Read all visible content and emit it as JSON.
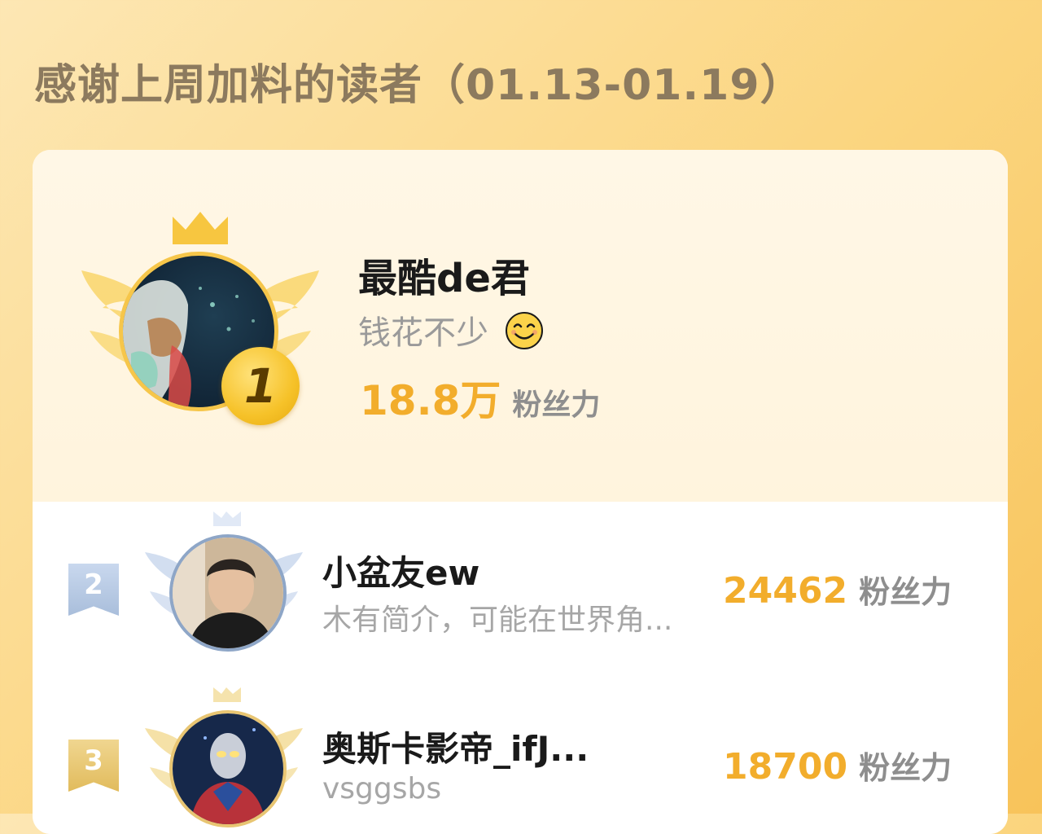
{
  "header": {
    "title": "感谢上周加料的读者（01.13-01.19）"
  },
  "colors": {
    "accent": "#f2ad2c",
    "background_start": "#fde7b4",
    "background_end": "#f8c35a",
    "gold": "#f6c64a",
    "silver": "#a9bedb",
    "bronze": "#e8c572"
  },
  "top_reader": {
    "rank": "1",
    "name": "最酷de君",
    "bio": "钱花不少",
    "bio_emoji": "smile-icon",
    "score": "18.8万",
    "score_unit": "粉丝力"
  },
  "readers": [
    {
      "rank": "2",
      "name": "小盆友ew",
      "bio": "木有简介，可能在世界角...",
      "score": "24462",
      "score_unit": "粉丝力"
    },
    {
      "rank": "3",
      "name": "奥斯卡影帝_ifJ...",
      "bio": "vsggsbs",
      "score": "18700",
      "score_unit": "粉丝力"
    }
  ]
}
